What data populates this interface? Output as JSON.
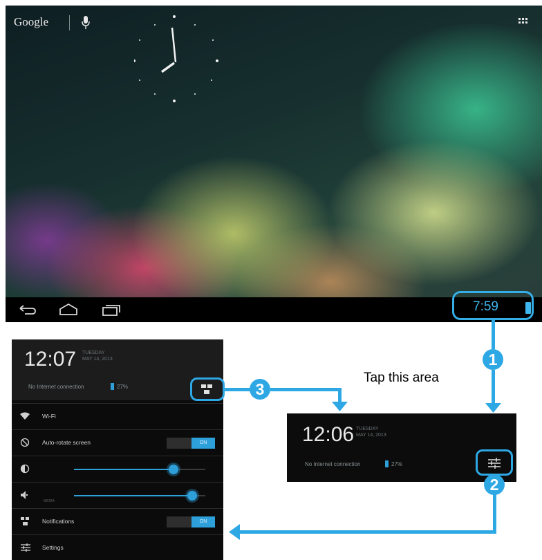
{
  "home": {
    "search_logo": "Google",
    "status_time": "7:59"
  },
  "annotation": {
    "tap_label": "Tap this area",
    "step1": "1",
    "step2": "2",
    "step3": "3",
    "accent_color": "#2ea8e5"
  },
  "quick_settings": {
    "time": "12:07",
    "day": "TUESDAY",
    "date": "MAY 14, 2013",
    "connection": "No Internet connection",
    "battery": "27%",
    "rows": [
      {
        "icon": "wifi-icon",
        "label": "Wi-Fi"
      },
      {
        "icon": "rotate-icon",
        "label": "Auto-rotate screen",
        "toggle": "ON"
      },
      {
        "icon": "brightness-icon",
        "label": ""
      },
      {
        "icon": "volume-icon",
        "label": "",
        "sublabel": "MEDIA"
      },
      {
        "icon": "notifications-icon",
        "label": "Notifications",
        "toggle": "ON"
      },
      {
        "icon": "settings-icon",
        "label": "Settings"
      }
    ],
    "brightness_level": 0.78,
    "volume_level": 0.93
  },
  "notification_shade": {
    "time": "12:06",
    "day": "TUESDAY",
    "date": "MAY 14, 2013",
    "connection": "No Internet connection",
    "battery": "27%"
  },
  "icons": {
    "mic": "mic-icon",
    "apps": "all-apps-icon",
    "back": "back-icon",
    "home": "home-icon",
    "recents": "recents-icon",
    "battery": "battery-icon",
    "quick_settings_toggle": "quick-settings-icon",
    "notifications_toggle": "notifications-switch-icon"
  }
}
